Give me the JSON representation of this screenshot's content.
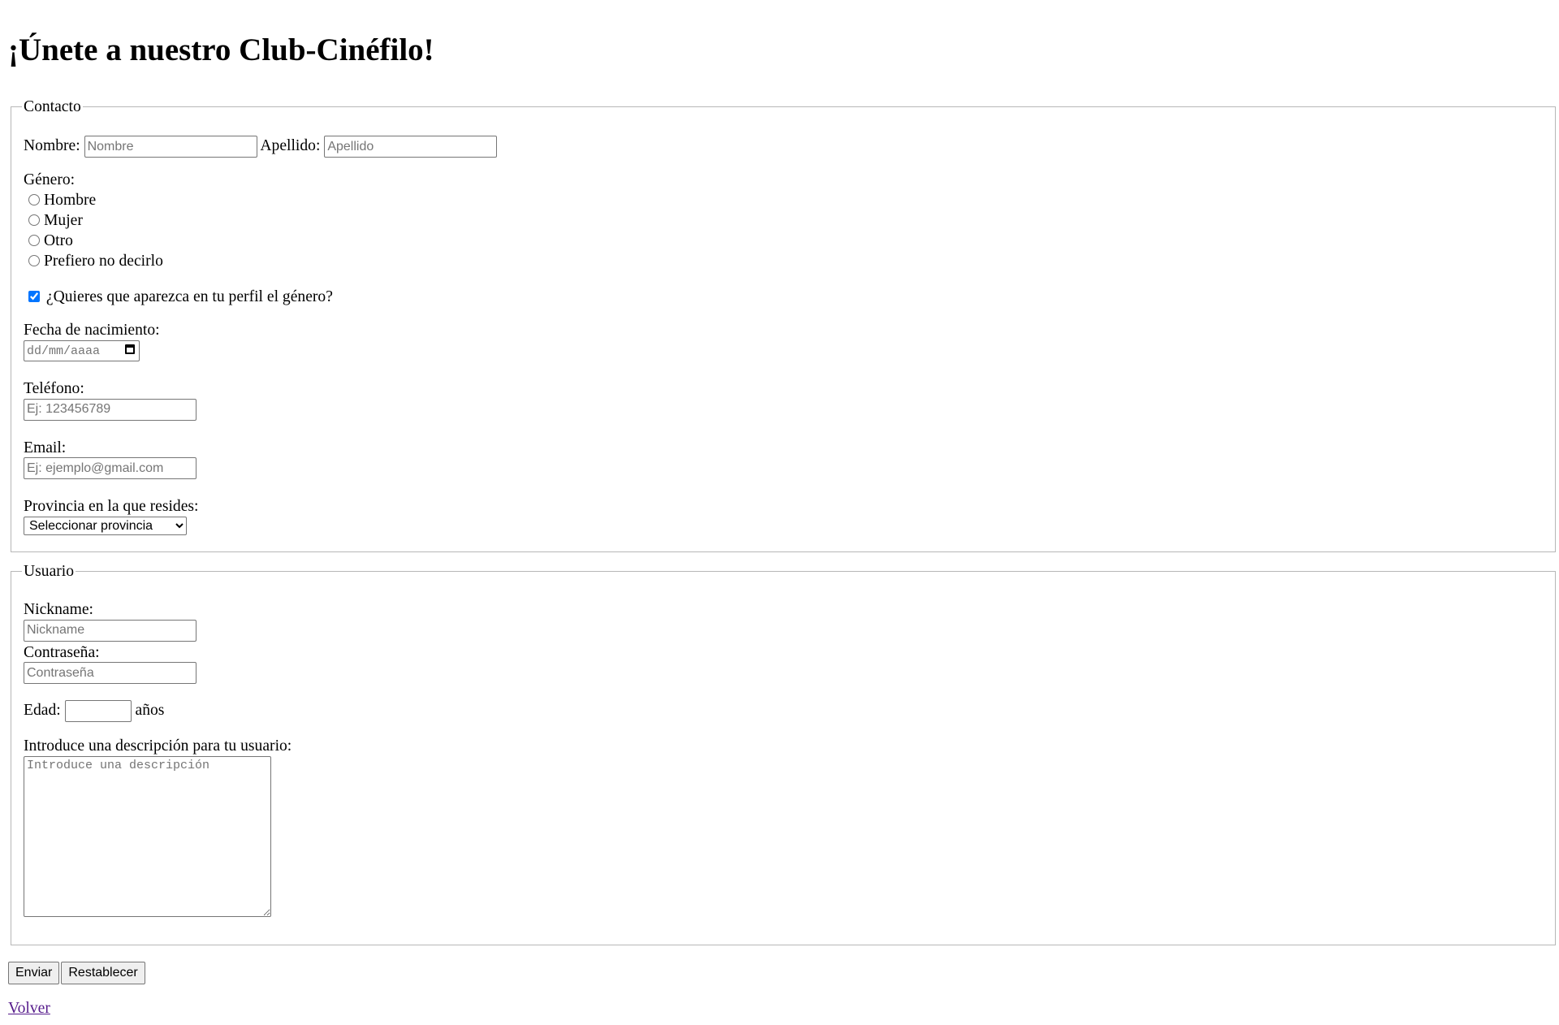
{
  "page": {
    "title": "¡Únete a nuestro Club-Cinéfilo!"
  },
  "contacto": {
    "legend": "Contacto",
    "nombre_label": "Nombre:",
    "nombre_placeholder": "Nombre",
    "apellido_label": "Apellido:",
    "apellido_placeholder": "Apellido",
    "genero_label": "Género:",
    "genero_options": [
      "Hombre",
      "Mujer",
      "Otro",
      "Prefiero no decirlo"
    ],
    "show_gender_label": "¿Quieres que aparezca en tu perfil el género?",
    "show_gender_checked": true,
    "fecha_label": "Fecha de nacimiento:",
    "fecha_placeholder": "dd/mm/aaaa",
    "telefono_label": "Teléfono:",
    "telefono_placeholder": "Ej: 123456789",
    "email_label": "Email:",
    "email_placeholder": "Ej: ejemplo@gmail.com",
    "provincia_label": "Provincia en la que resides:",
    "provincia_selected": "Seleccionar provincia"
  },
  "usuario": {
    "legend": "Usuario",
    "nickname_label": "Nickname:",
    "nickname_placeholder": "Nickname",
    "password_label": "Contraseña:",
    "password_placeholder": "Contraseña",
    "edad_label": "Edad:",
    "edad_suffix": "años",
    "descripcion_label": "Introduce una descripción para tu usuario:",
    "descripcion_placeholder": "Introduce una descripción"
  },
  "actions": {
    "submit_label": "Enviar",
    "reset_label": "Restablecer",
    "back_link": "Volver"
  }
}
